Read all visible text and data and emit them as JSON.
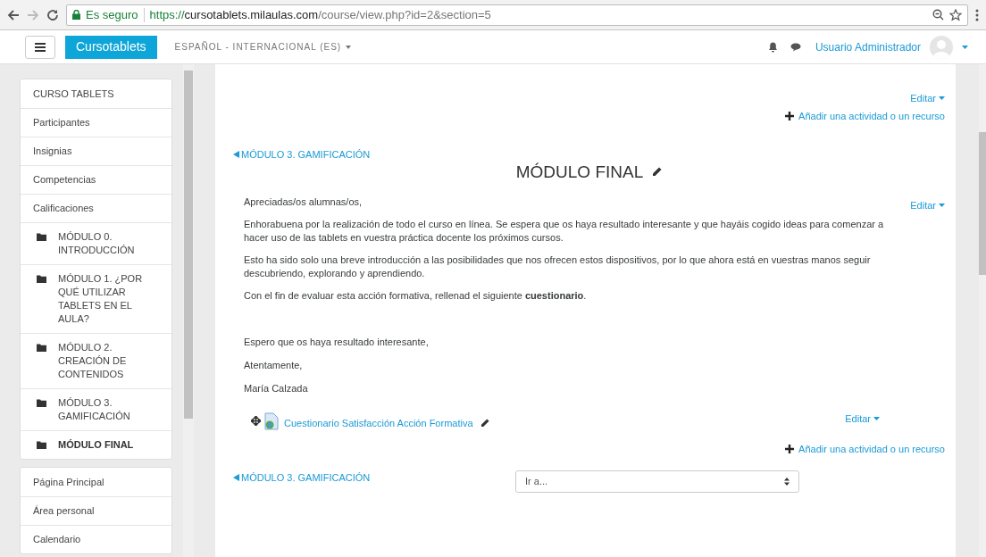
{
  "browser": {
    "security_label": "Es seguro",
    "url_host_prefix": "https://",
    "url_host": "cursotablets.milaulas.com",
    "url_path": "/course/view.php?id=2&section=5"
  },
  "navbar": {
    "brand": "Cursotablets",
    "language": "ESPAÑOL - INTERNACIONAL (ES)",
    "user_name": "Usuario Administrador"
  },
  "sidebar": {
    "groups": [
      {
        "items": [
          {
            "label": "CURSO TABLETS",
            "kind": "link",
            "selected": false
          },
          {
            "label": "Participantes",
            "kind": "link",
            "selected": false
          },
          {
            "label": "Insignias",
            "kind": "link",
            "selected": false
          },
          {
            "label": "Competencias",
            "kind": "link",
            "selected": false
          },
          {
            "label": "Calificaciones",
            "kind": "link",
            "selected": false
          },
          {
            "label": "MÓDULO 0. INTRODUCCIÓN",
            "kind": "section",
            "selected": false
          },
          {
            "label": "MÓDULO 1. ¿POR QUÉ UTILIZAR TABLETS EN EL AULA?",
            "kind": "section",
            "selected": false
          },
          {
            "label": "MÓDULO 2. CREACIÓN DE CONTENIDOS",
            "kind": "section",
            "selected": false
          },
          {
            "label": "MÓDULO 3. GAMIFICACIÓN",
            "kind": "section",
            "selected": false
          },
          {
            "label": "MÓDULO FINAL",
            "kind": "section",
            "selected": true
          }
        ]
      },
      {
        "items": [
          {
            "label": "Página Principal",
            "kind": "link",
            "selected": false
          },
          {
            "label": "Área personal",
            "kind": "link",
            "selected": false
          },
          {
            "label": "Calendario",
            "kind": "link",
            "selected": false
          }
        ]
      }
    ]
  },
  "content": {
    "top_edit": "Editar",
    "top_add": "Añadir una actividad o un recurso",
    "prev_section": "MÓDULO 3. GAMIFICACIÓN",
    "title": "MÓDULO FINAL",
    "summary_edit": "Editar",
    "paragraphs": [
      "Apreciadas/os alumnas/os,",
      "Enhorabuena por la realización de todo el curso en línea. Se espera que os haya resultado interesante y que hayáis cogido ideas para comenzar a hacer uso de las tablets en vuestra práctica docente los próximos cursos.",
      "Esto ha sido solo una breve introducción a las posibilidades que nos ofrecen estos dispositivos, por lo que ahora está en vuestras manos seguir descubriendo, explorando y aprendiendo.",
      "Con el fin de evaluar esta acción formativa, rellenad el siguiente **cuestionario**."
    ],
    "closing": [
      "Espero que os haya resultado interesante,",
      "Atentamente,",
      "María Calzada"
    ],
    "activity": {
      "name": "Cuestionario Satisfacción Acción Formativa",
      "edit": "Editar"
    },
    "bottom_add": "Añadir una actividad o un recurso",
    "bottom_prev_section": "MÓDULO 3. GAMIFICACIÓN",
    "jump_select": {
      "value": "Ir a..."
    }
  }
}
